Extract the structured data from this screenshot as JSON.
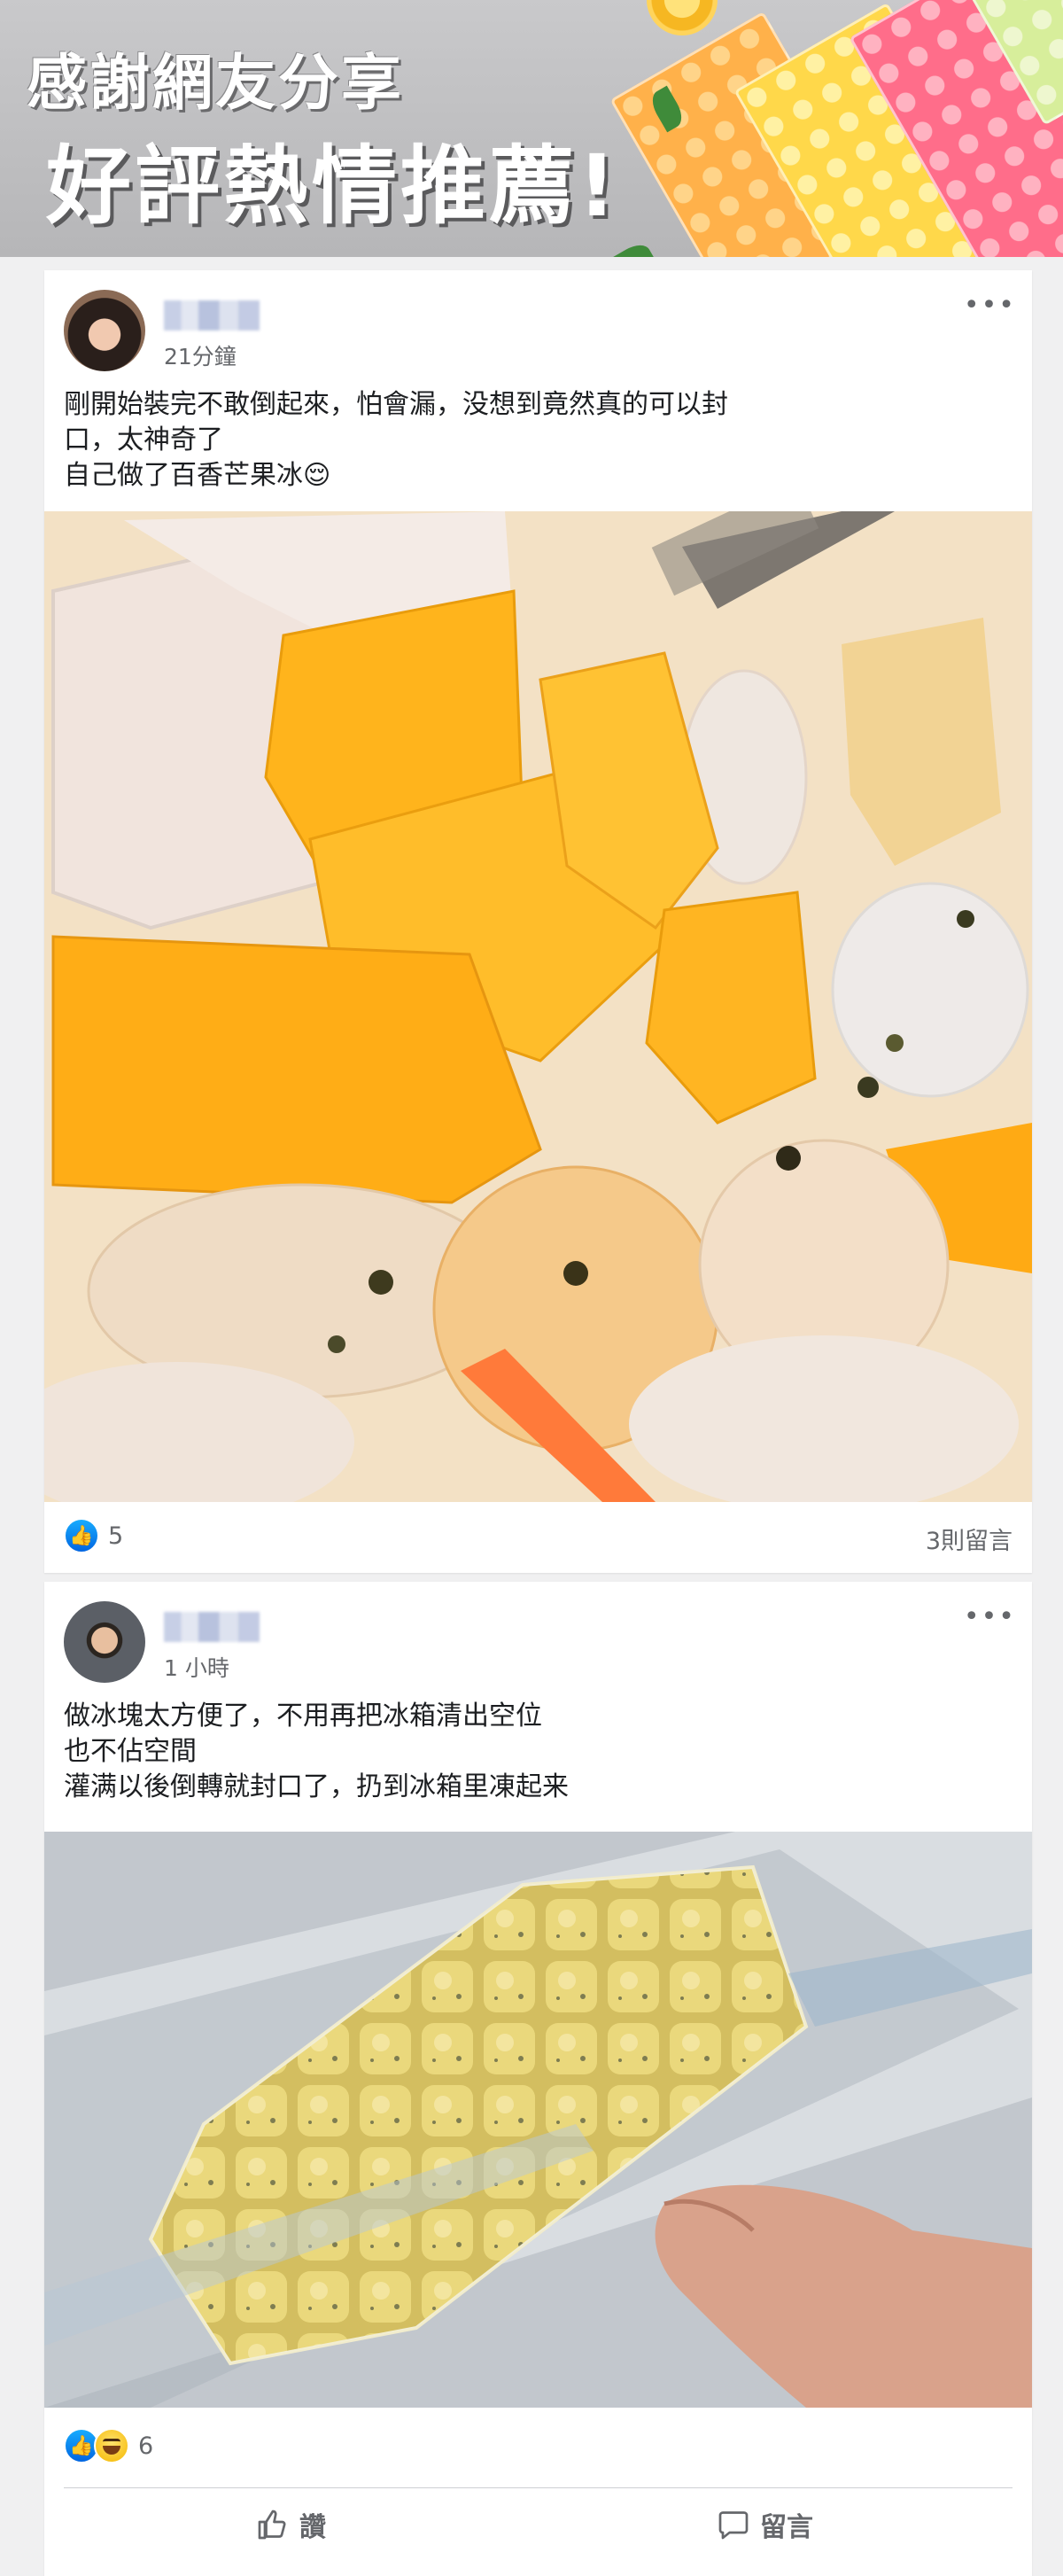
{
  "banner": {
    "line1": "感謝網友分享",
    "line2": "好評熱情推薦!"
  },
  "posts": [
    {
      "time": "21分鐘",
      "text": "剛開始裝完不敢倒起來，怕會漏，没想到竟然真的可以封\n口，太神奇了\n自己做了百香芒果冰😌",
      "reaction_count": "5",
      "comments": "3則留言",
      "reactions": [
        "like-icon"
      ]
    },
    {
      "time": "1 小時",
      "text": "做冰塊太方便了，不用再把冰箱清出空位\n也不佔空間\n灌满以後倒轉就封口了，扔到冰箱里凍起来",
      "reaction_count": "6",
      "reactions": [
        "like-icon",
        "haha-icon"
      ],
      "actions": {
        "like": "讚",
        "comment": "留言"
      }
    }
  ],
  "colors": {
    "facebook_blue": "#1877f2",
    "secondary_text": "#65676b",
    "divider": "#ced0d4"
  }
}
